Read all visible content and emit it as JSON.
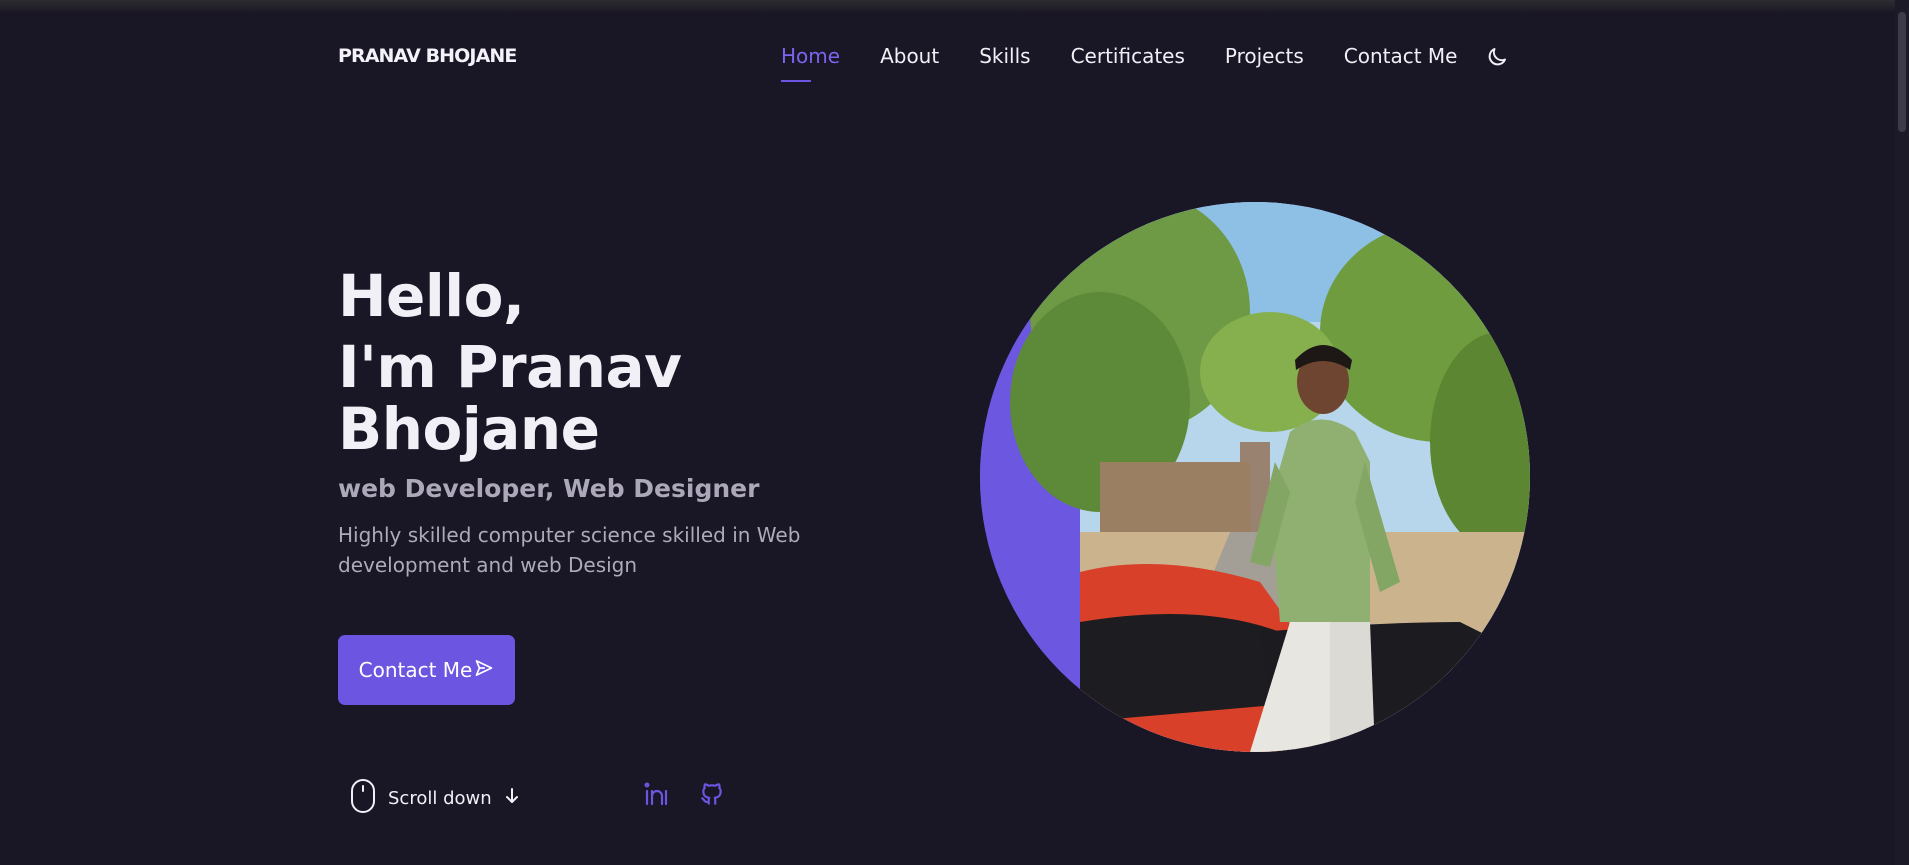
{
  "brand": {
    "logo": "PRANAV BHOJANE"
  },
  "nav": {
    "items": [
      {
        "label": "Home",
        "active": true
      },
      {
        "label": "About"
      },
      {
        "label": "Skills"
      },
      {
        "label": "Certificates"
      },
      {
        "label": "Projects"
      },
      {
        "label": "Contact Me"
      }
    ],
    "theme_icon": "moon-icon"
  },
  "hero": {
    "greeting": "Hello,",
    "name": "I'm Pranav Bhojane",
    "role": "web Developer, Web Designer",
    "description": "Highly skilled computer science skilled in Web development and web Design",
    "cta_label": "Contact Me",
    "cta_icon": "send-icon"
  },
  "scroll": {
    "label": "Scroll down",
    "icon": "mouse-icon",
    "arrow_icon": "arrow-down-icon"
  },
  "social": [
    {
      "icon": "linkedin-icon"
    },
    {
      "icon": "github-icon"
    }
  ],
  "colors": {
    "accent": "#6c55e0",
    "background": "#191625",
    "text": "#f2f0f7",
    "muted": "#aca8b9"
  }
}
